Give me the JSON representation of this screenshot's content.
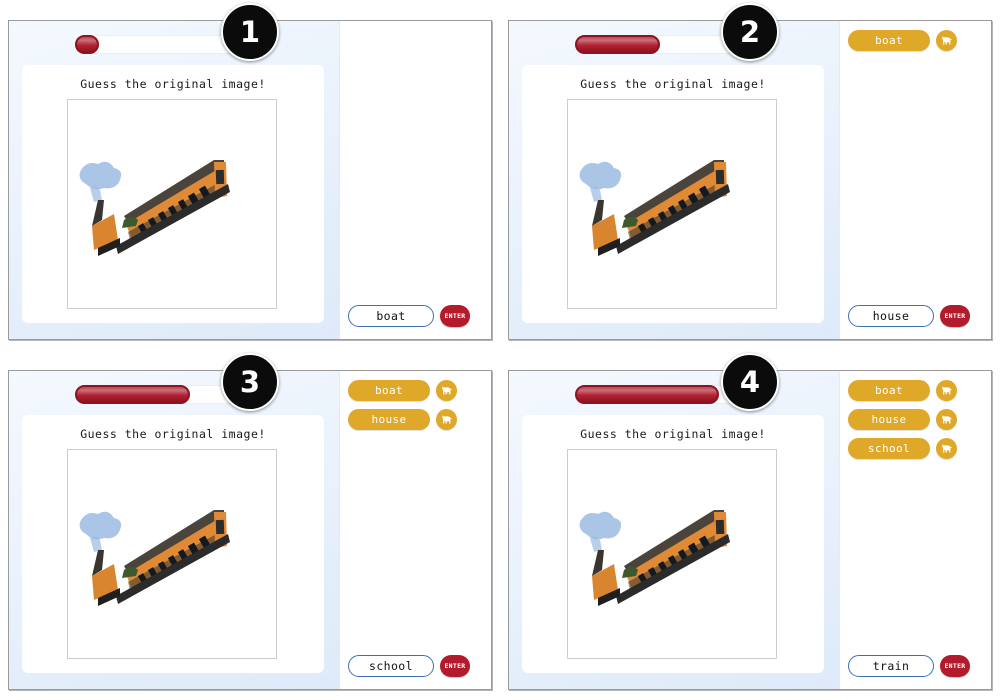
{
  "panels": [
    {
      "badge": "1",
      "progress_percent": 13,
      "title": "Guess the original image!",
      "reveal": 1,
      "chips": [],
      "answer_value": "boat",
      "answer_placeholder": "",
      "enter_label": "ENTER"
    },
    {
      "badge": "2",
      "progress_percent": 46,
      "title": "Guess the original image!",
      "reveal": 2,
      "chips": [
        {
          "label": "boat",
          "icon": "dog-icon"
        }
      ],
      "answer_value": "house",
      "answer_placeholder": "",
      "enter_label": "ENTER"
    },
    {
      "badge": "3",
      "progress_percent": 62,
      "title": "Guess the original image!",
      "reveal": 3,
      "chips": [
        {
          "label": "boat",
          "icon": "dog-icon"
        },
        {
          "label": "house",
          "icon": "dog-icon"
        }
      ],
      "answer_value": "school",
      "answer_placeholder": "",
      "enter_label": "ENTER"
    },
    {
      "badge": "4",
      "progress_percent": 78,
      "title": "Guess the original image!",
      "reveal": 4,
      "chips": [
        {
          "label": "boat",
          "icon": "dog-icon"
        },
        {
          "label": "house",
          "icon": "dog-icon"
        },
        {
          "label": "school",
          "icon": "dog-icon"
        }
      ],
      "answer_value": "train",
      "answer_placeholder": "",
      "enter_label": "ENTER"
    }
  ],
  "colors": {
    "chip_gold": "#dfa829",
    "enter_red": "#b31b2c",
    "progress_red": "#b22234",
    "progress_border": "#8e121f",
    "input_border": "#3f6fb5",
    "badge_black": "#0b0b0b",
    "panel_bg": "#dbe8f9",
    "train_orange": "#e08a35",
    "sky_blue": "#6d94cc",
    "grass_green": "#7f9155"
  }
}
